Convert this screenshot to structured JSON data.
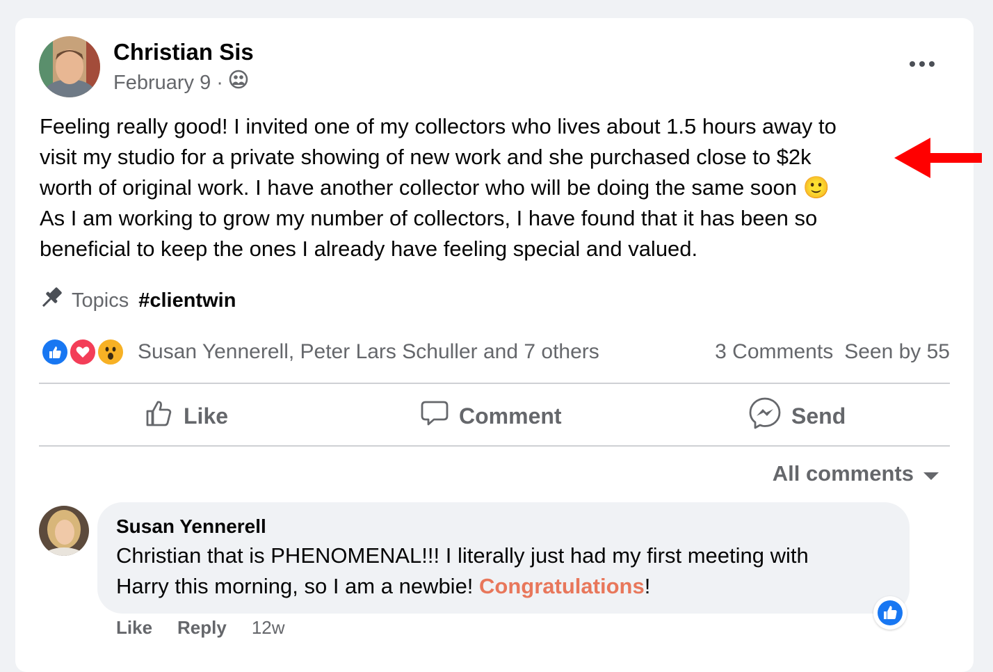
{
  "post": {
    "author": "Christian Sis",
    "date": "February 9",
    "separator": "·",
    "privacy_icon": "group-icon",
    "more_icon": "more-horizontal-icon",
    "text_lines": [
      "Feeling really good! I invited one of my collectors who lives about 1.5 hours away to",
      "visit my studio for a private showing of new work and she purchased close to $2k",
      "worth of original work. I have another collector who will be doing the same soon 🙂",
      "As I am working to grow my number of collectors, I have found that it has been so",
      "beneficial to keep the ones I already have feeling special and valued."
    ],
    "annotation_arrow_color": "#ff0000",
    "topics_label": "Topics",
    "topic_tag": "#clientwin",
    "reaction_icons": [
      "like-reaction-icon",
      "love-reaction-icon",
      "wow-reaction-icon"
    ],
    "reactors": "Susan Yennerell, Peter Lars Schuller and 7 others",
    "comments_count": "3 Comments",
    "seen_by": "Seen by 55"
  },
  "actions": {
    "like": "Like",
    "comment": "Comment",
    "send": "Send"
  },
  "comments": {
    "filter_label": "All comments",
    "items": [
      {
        "author": "Susan Yennerell",
        "line1": "Christian that is PHENOMENAL!!! I literally just had my first meeting with",
        "line2_before": "Harry this morning, so I am a newbie! ",
        "line2_link": "Congratulations",
        "line2_after": "!",
        "like": "Like",
        "reply": "Reply",
        "age": "12w"
      }
    ]
  },
  "colors": {
    "facebook_blue": "#1877f2",
    "love_red": "#f33e58",
    "secondary_text": "#65676b",
    "link_orange": "#e8775b"
  }
}
